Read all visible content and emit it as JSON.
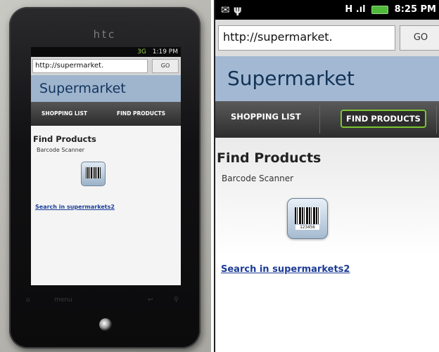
{
  "phone_photo": {
    "brand": "htc",
    "status_time": "1:19 PM",
    "status_network": "3G",
    "url": "http://supermarket.",
    "go_label": "GO",
    "site_title": "Supermarket",
    "tabs": [
      "SHOPPING LIST",
      "FIND PRODUCTS"
    ],
    "heading": "Find Products",
    "subheading": "Barcode Scanner",
    "link": "Search in supermarkets2",
    "hw_menu_label": "menu"
  },
  "screenshot": {
    "status_time": "8:25 PM",
    "status_network": "H",
    "url": "http://supermarket.",
    "go_label": "GO",
    "site_title": "Supermarket",
    "tabs": {
      "shopping_list": "SHOPPING LIST",
      "find_products": "FIND PRODUCTS",
      "active": "find_products"
    },
    "heading": "Find Products",
    "subheading": "Barcode Scanner",
    "barcode_number": "123456",
    "link": "Search in supermarkets2"
  },
  "colors": {
    "header_bg": "#a3b9d3",
    "active_tab_border": "#7cc531",
    "link": "#1c3b96"
  }
}
